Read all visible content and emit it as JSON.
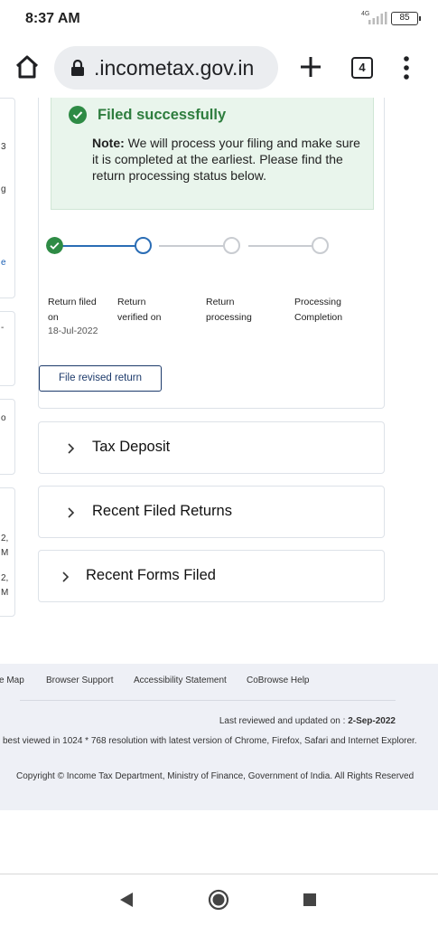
{
  "status_bar": {
    "time": "8:37 AM",
    "network": "4G",
    "battery": "85"
  },
  "browser": {
    "url": ".incometax.gov.in",
    "tab_count": "4"
  },
  "left_cards": [
    {
      "lines": [
        "3",
        "g",
        "e"
      ]
    },
    {
      "lines": [
        "-"
      ]
    },
    {
      "lines": [
        "o"
      ]
    },
    {
      "lines": [
        "2,",
        "M",
        "2,",
        "M"
      ]
    }
  ],
  "status_card": {
    "success_title": "Filed successfully",
    "note_label": "Note:",
    "note_text": " We will process your filing and make sure it is completed at the earliest. Please find the return processing status below.",
    "steps": [
      {
        "label_line1": "Return filed",
        "label_line2": "on",
        "date": "18-Jul-2022",
        "state": "done"
      },
      {
        "label_line1": "Return",
        "label_line2": "verified on",
        "date": "",
        "state": "current"
      },
      {
        "label_line1": "Return",
        "label_line2": "processing",
        "date": "",
        "state": "pending"
      },
      {
        "label_line1": "Processing",
        "label_line2": "Completion",
        "date": "",
        "state": "pending"
      }
    ],
    "revise_button": "File revised return"
  },
  "accordions": [
    {
      "title": "Tax Deposit"
    },
    {
      "title": "Recent Filed Returns"
    },
    {
      "title": "Recent Forms Filed"
    }
  ],
  "footer": {
    "links": [
      "e Map",
      "Browser Support",
      "Accessibility Statement",
      "CoBrowse Help"
    ],
    "updated_label": "Last reviewed and updated on : ",
    "updated_date": "2-Sep-2022",
    "resolution_text": "best viewed in 1024 * 768 resolution with latest version of Chrome, Firefox, Safari and Internet Explorer.",
    "copyright": "Copyright © Income Tax Department, Ministry of Finance, Government of India. All Rights Reserved"
  },
  "colors": {
    "success_green": "#2e8b45",
    "step_blue": "#2a6db5",
    "step_grey": "#c9ccd1",
    "brand_navy": "#1c3a6b",
    "footer_bg": "#eef0f6"
  }
}
